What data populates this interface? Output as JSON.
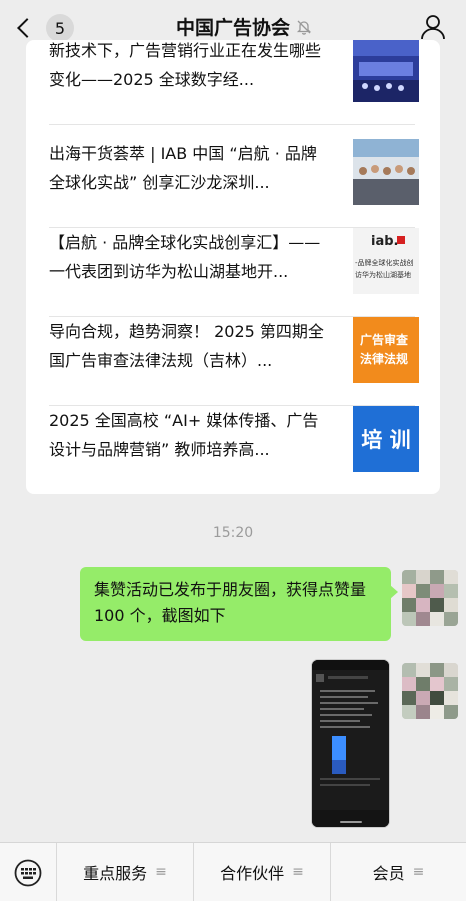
{
  "header": {
    "back_count": "5",
    "title": "中国广告协会"
  },
  "articles": [
    {
      "title": "新技术下，广告营销行业正在发生哪些变化——2025 全球数字经..."
    },
    {
      "title": "出海干货荟萃 | IAB 中国 “启航 · 品牌全球化实战” 创享汇沙龙深圳..."
    },
    {
      "title": "【启航 · 品牌全球化实战创享汇】——一代表团到访华为松山湖基地开..."
    },
    {
      "title": "导向合规，趋势洞察！ 2025 第四期全国广告审查法律法规（吉林）..."
    },
    {
      "title": "2025 全国高校 “AI+ 媒体传播、广告设计与品牌营销” 教师培养高..."
    }
  ],
  "thumbs": {
    "iab_logo": "iab.",
    "iab_caption_1": "-品牌全球化实战创",
    "iab_caption_2": "访华为松山湖基地",
    "ad_review_1": "广告审查",
    "ad_review_2": "法律法规",
    "training": "培 训"
  },
  "chat": {
    "time": "15:20",
    "message": "集赞活动已发布于朋友圈，获得点赞量 100 个，截图如下"
  },
  "bottom_menu": [
    {
      "label": "重点服务"
    },
    {
      "label": "合作伙伴"
    },
    {
      "label": "会员"
    }
  ],
  "colors": {
    "bubble": "#95ec69",
    "background": "#ededed",
    "card": "#ffffff"
  },
  "icons": {
    "back": "chevron-left-icon",
    "mute": "bell-off-icon",
    "profile": "person-icon",
    "keyboard": "keyboard-icon",
    "menu": "hamburger-icon"
  }
}
